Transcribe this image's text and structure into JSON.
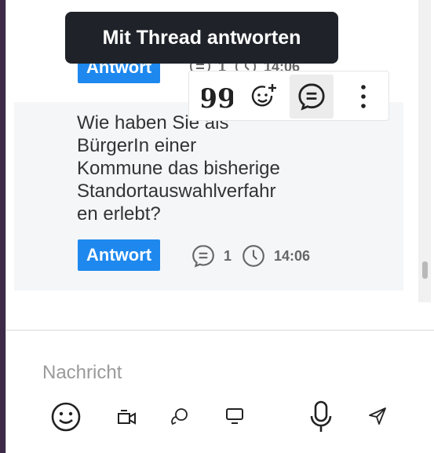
{
  "tooltip": {
    "text": "Mit Thread antworten"
  },
  "messages": [
    {
      "answer_label": "Antwort",
      "reply_count": "1",
      "time": "14:06"
    },
    {
      "text": "Wie haben Sie als BürgerIn einer Kommune das bisherige Standortauswahlverfahren erlebt?",
      "text_lines": [
        "Wie haben Sie als",
        "BürgerIn einer",
        "Kommune das bisherige",
        "Standortauswahlverfahr",
        "en erlebt?"
      ],
      "answer_label": "Antwort",
      "reply_count": "1",
      "time": "14:06"
    }
  ],
  "message_actions": {
    "icons": [
      "quote-icon",
      "add-reaction-icon",
      "reply-in-thread-icon",
      "more-options-icon"
    ],
    "active": "reply-in-thread-icon"
  },
  "composer": {
    "placeholder": "Nachricht",
    "icons": [
      "emoji-icon",
      "video-message-icon",
      "discussion-icon",
      "screen-share-icon",
      "microphone-icon",
      "send-icon"
    ]
  },
  "colors": {
    "accent": "#1e88ee",
    "tooltip_bg": "#1f2329",
    "sidebar": "#3c2a48",
    "message_bg": "#f5f6f8"
  }
}
